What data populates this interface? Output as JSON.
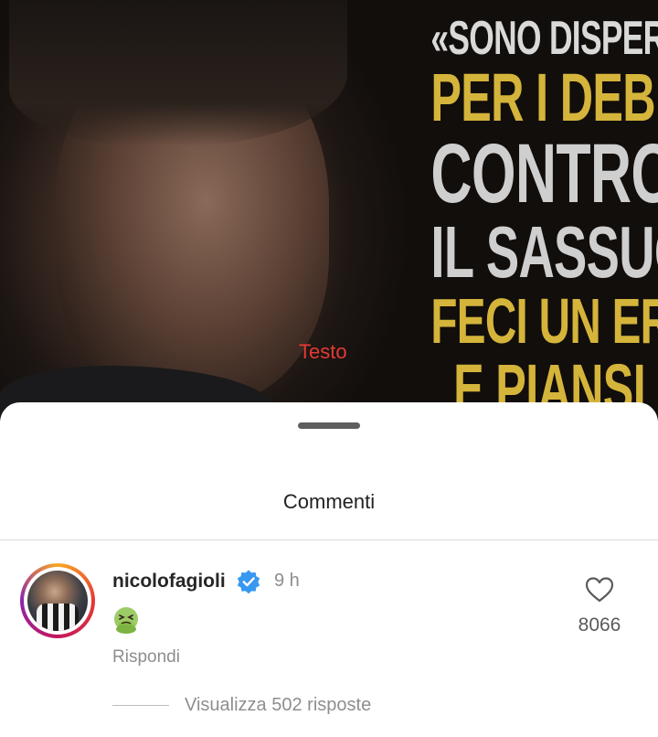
{
  "post": {
    "headline": {
      "line1": "«SONO DISPERATO",
      "line2": "PER I DEBITI.",
      "line3": "CONTRO",
      "line4": "IL SASSUOLO",
      "line5": "FECI UN ERRORE",
      "line6": "E PIANSI"
    },
    "overlay_text": "Testo"
  },
  "comments_sheet": {
    "title": "Commenti",
    "comment": {
      "username": "nicolofagioli",
      "verified_icon": "verified-badge-icon",
      "time": "9 h",
      "emoji_icon": "nauseated-face-emoji",
      "reply_label": "Rispondi",
      "like_icon": "heart-outline-icon",
      "like_count": "8066",
      "view_replies": "Visualizza 502 risposte"
    }
  },
  "colors": {
    "headline_gold": "#d4b43a",
    "headline_grey": "#cfcfcf",
    "overlay_red": "#e53935",
    "verified_blue": "#3897f0",
    "secondary_text": "#8e8e8e"
  }
}
